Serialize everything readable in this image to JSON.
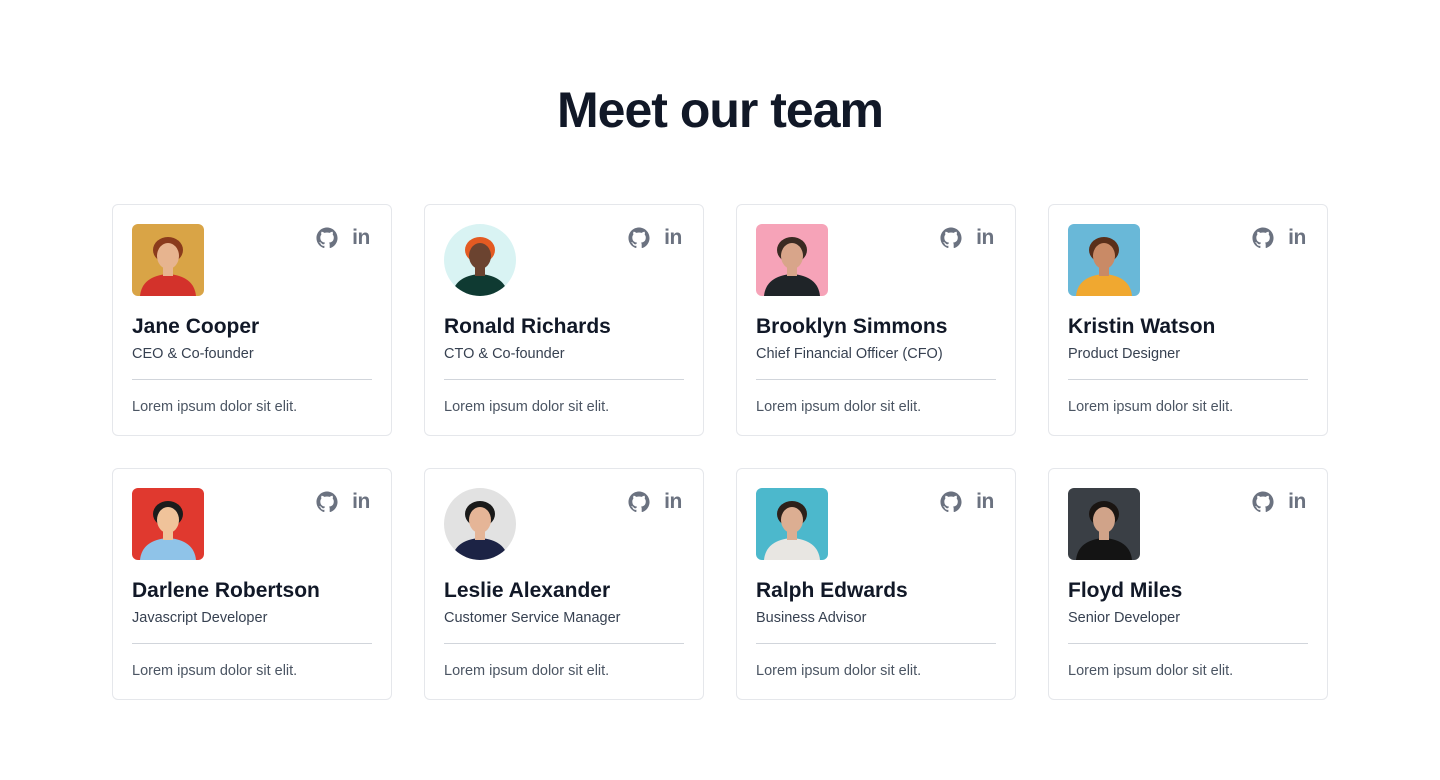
{
  "page": {
    "title": "Meet our team"
  },
  "team": [
    {
      "name": "Jane Cooper",
      "role": "CEO & Co-founder",
      "description": "Lorem ipsum dolor sit elit.",
      "avatar_shape": "rounded-square",
      "avatar_bg": "#d9a446",
      "skin": "#e7b48f",
      "hair": "#8a3b1c",
      "shirt": "#d3322b"
    },
    {
      "name": "Ronald Richards",
      "role": "CTO & Co-founder",
      "description": "Lorem ipsum dolor sit elit.",
      "avatar_shape": "circle",
      "avatar_bg": "#d9f3f3",
      "skin": "#6b4330",
      "hair": "#e35a22",
      "shirt": "#0f3a32"
    },
    {
      "name": "Brooklyn Simmons",
      "role": "Chief Financial Officer (CFO)",
      "description": "Lorem ipsum dolor sit elit.",
      "avatar_shape": "rounded-square",
      "avatar_bg": "#f6a3b8",
      "skin": "#d8a58a",
      "hair": "#3a2a22",
      "shirt": "#1f2428"
    },
    {
      "name": "Kristin Watson",
      "role": "Product Designer",
      "description": "Lorem ipsum dolor sit elit.",
      "avatar_shape": "rounded-square",
      "avatar_bg": "#69b8d8",
      "skin": "#c98a66",
      "hair": "#5a2f1a",
      "shirt": "#f0a830"
    },
    {
      "name": "Darlene Robertson",
      "role": "Javascript Developer",
      "description": "Lorem ipsum dolor sit elit.",
      "avatar_shape": "rounded-square",
      "avatar_bg": "#e0392f",
      "skin": "#f0c39a",
      "hair": "#1c1c1c",
      "shirt": "#8fc3e8"
    },
    {
      "name": "Leslie Alexander",
      "role": "Customer Service Manager",
      "description": "Lorem ipsum dolor sit elit.",
      "avatar_shape": "circle",
      "avatar_bg": "#e2e2e2",
      "skin": "#e5b597",
      "hair": "#1a1a1a",
      "shirt": "#1c2345"
    },
    {
      "name": "Ralph Edwards",
      "role": "Business Advisor",
      "description": "Lorem ipsum dolor sit elit.",
      "avatar_shape": "rounded-square",
      "avatar_bg": "#4cb8cc",
      "skin": "#dcae92",
      "hair": "#2d211a",
      "shirt": "#e8e6e2"
    },
    {
      "name": "Floyd Miles",
      "role": "Senior Developer",
      "description": "Lorem ipsum dolor sit elit.",
      "avatar_shape": "rounded-square",
      "avatar_bg": "#3a3f45",
      "skin": "#d0a389",
      "hair": "#1a1512",
      "shirt": "#141414"
    }
  ],
  "social_icons": [
    "github-icon",
    "linkedin-icon"
  ],
  "social_labels": {
    "linkedin": "in"
  },
  "colors": {
    "heading": "#111827",
    "icon": "#6b7280",
    "border": "#e5e7eb"
  }
}
